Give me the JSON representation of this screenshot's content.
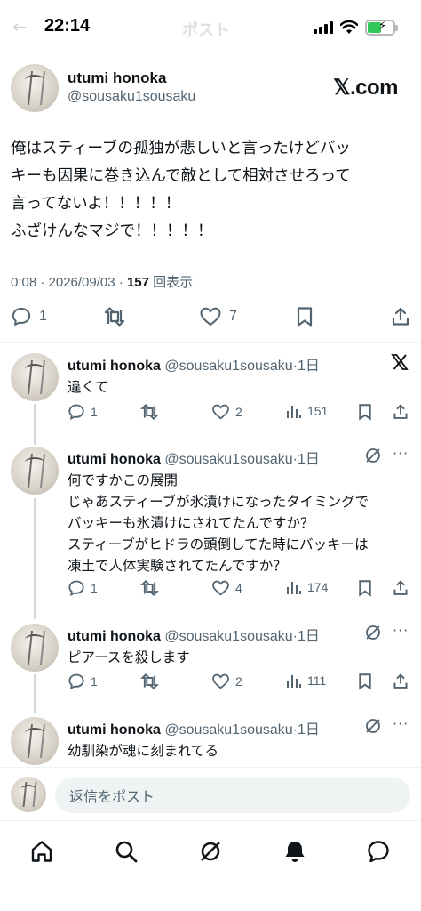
{
  "status_bar": {
    "time": "22:14",
    "ghost_title": "ポスト",
    "ghost_back": "←"
  },
  "main_post": {
    "name": "utumi honoka",
    "handle": "@sousaku1sousaku",
    "brand": "𝕏.com",
    "text_lines": [
      "俺はスティーブの孤独が悲しいと言ったけどバッ",
      "キーも因果に巻き込んで敵として相対させろって",
      "言ってないよ！！！！！",
      "ふざけんなマジで！！！！！"
    ],
    "meta_prefix": "0:08 · 2026/09/03 · ",
    "views": "157",
    "views_label": " 回表示",
    "reply_count": "1",
    "like_count": "7"
  },
  "replies": [
    {
      "name": "utumi honoka",
      "handle": " @sousaku1sousaku",
      "time": "·1日",
      "lines": [
        "違くて"
      ],
      "reply_count": "1",
      "like_count": "2",
      "view_count": "151",
      "corner_icon": "x-logo-icon"
    },
    {
      "name": "utumi honoka",
      "handle": " @sousaku1sousaku",
      "time": "·1日",
      "lines": [
        "何ですかこの展開",
        "じゃあスティーブが氷漬けになったタイミングで",
        "バッキーも氷漬けにされてたんですか？",
        "スティーブがヒドラの頭倒してた時にバッキーは",
        "凍土で人体実験されてたんですか？"
      ],
      "reply_count": "1",
      "like_count": "4",
      "view_count": "174",
      "corner_icon": "grok-icon"
    },
    {
      "name": "utumi honoka",
      "handle": " @sousaku1sousaku",
      "time": "·1日",
      "lines": [
        "ピアースを殺します"
      ],
      "reply_count": "1",
      "like_count": "2",
      "view_count": "111",
      "corner_icon": "grok-icon"
    },
    {
      "name": "utumi honoka",
      "handle": " @sousaku1sousaku",
      "time": "·1日",
      "lines": [
        "幼馴染が魂に刻まれてる"
      ],
      "corner_icon": "grok-icon"
    }
  ],
  "reply_bar": {
    "placeholder": "返信をポスト"
  },
  "colors": {
    "text": "#0f1419",
    "muted": "#536471",
    "divider": "#eff3f4",
    "battery": "#32c759"
  }
}
